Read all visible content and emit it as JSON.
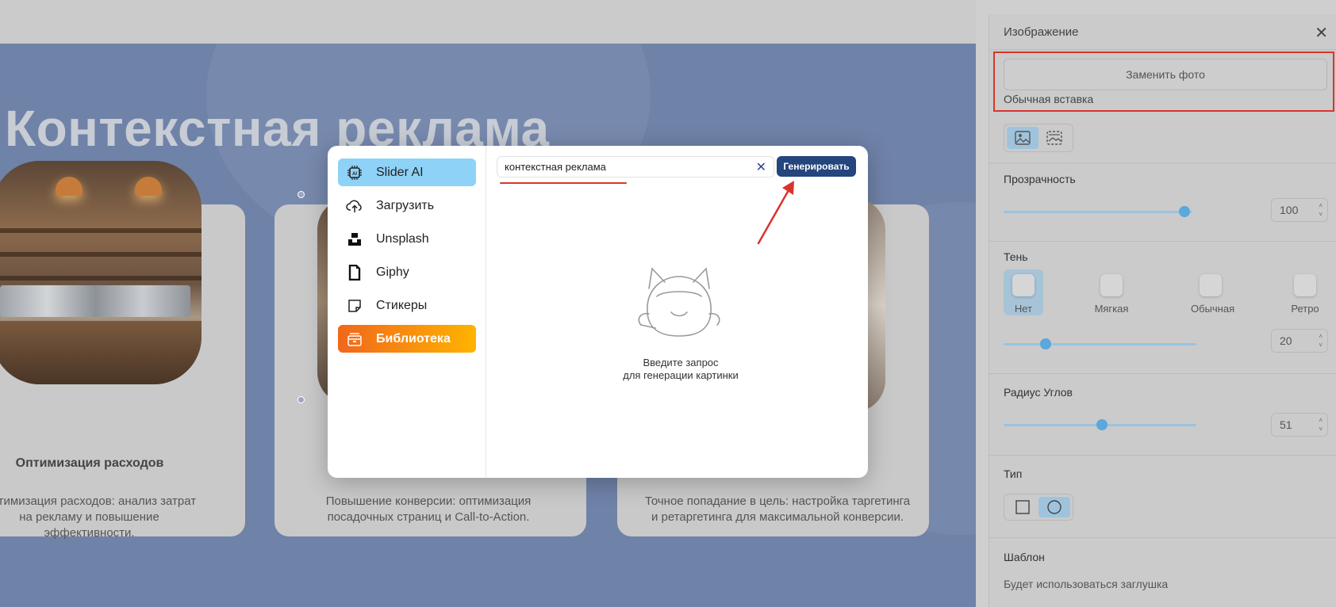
{
  "slide": {
    "title": "Контекстная реклама",
    "cards": [
      {
        "title": "Оптимизация расходов",
        "text": "Оптимизация расходов: анализ затрат на рекламу и повышение эффективности."
      },
      {
        "title": "",
        "text": "Повышение конверсии: оптимизация посадочных страниц и Call-to-Action."
      },
      {
        "title": "",
        "text": "Точное попадание в цель: настройка таргетинга и ретаргетинга для максимальной конверсии."
      }
    ]
  },
  "dialog": {
    "menu": [
      {
        "label": "Slider AI",
        "icon": "ai-chip-icon"
      },
      {
        "label": "Загрузить",
        "icon": "cloud-upload-icon"
      },
      {
        "label": "Unsplash",
        "icon": "unsplash-icon"
      },
      {
        "label": "Giphy",
        "icon": "giphy-icon"
      },
      {
        "label": "Стикеры",
        "icon": "sticker-icon"
      },
      {
        "label": "Библиотека",
        "icon": "library-icon"
      }
    ],
    "search_value": "контекстная реклама",
    "clear_label": "✕",
    "generate_label": "Генерировать",
    "empty_line1": "Введите запрос",
    "empty_line2": "для генерации картинки"
  },
  "panel": {
    "header": "Изображение",
    "close": "✕",
    "replace_label": "Заменить фото",
    "insert_label": "Обычная вставка",
    "opacity_label": "Прозрачность",
    "opacity_value": "100",
    "opacity_fraction": 0.96,
    "shadow_label": "Тень",
    "shadow_options": [
      "Нет",
      "Мягкая",
      "Обычная",
      "Ретро"
    ],
    "shadow_value": "20",
    "shadow_fraction": 0.22,
    "radius_label": "Радиус Углов",
    "radius_value": "51",
    "radius_fraction": 0.51,
    "type_label": "Тип",
    "template_label": "Шаблон",
    "template_note": "Будет использоваться заглушка"
  },
  "colors": {
    "accent_blue": "#24457d",
    "highlight_red": "#d9342b",
    "ai_active": "#8fd2f7",
    "slide_bg": "#6f82a8"
  }
}
